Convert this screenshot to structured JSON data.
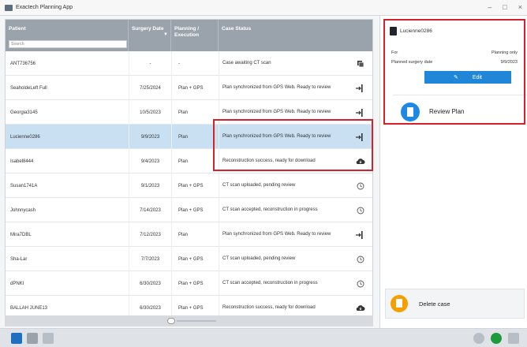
{
  "window": {
    "title": "Exactech Planning App"
  },
  "table": {
    "headers": [
      "Patient",
      "Surgery Date",
      "Planning / Execution",
      "Case Status"
    ],
    "filter_placeholder": "Search",
    "rows": [
      {
        "patient": "ANT736756",
        "date": "-",
        "planning": "-",
        "status": "Case awaiting CT scan",
        "icon": "copy-icon"
      },
      {
        "patient": "SeaholdeLeft Full",
        "date": "7/25/2024",
        "planning": "Plan + GPS",
        "status": "Plan synchronized from GPS Web. Ready to review",
        "icon": "arrow-icon"
      },
      {
        "patient": "Georgia3145",
        "date": "10/5/2023",
        "planning": "Plan",
        "status": "Plan synchronized from GPS Web. Ready to review",
        "icon": "arrow-icon"
      },
      {
        "patient": "Lucienne0286",
        "date": "9/9/2023",
        "planning": "Plan",
        "status": "Plan synchronized from GPS Web. Ready to review",
        "icon": "arrow-icon"
      },
      {
        "patient": "Isabel8444",
        "date": "9/4/2023",
        "planning": "Plan",
        "status": "Reconstruction success, ready for download",
        "icon": "cloud-icon"
      },
      {
        "patient": "Susan1741A",
        "date": "9/1/2023",
        "planning": "Plan + GPS",
        "status": "CT scan uploaded, pending review",
        "icon": "clock-icon"
      },
      {
        "patient": "Johnnycash",
        "date": "7/14/2023",
        "planning": "Plan + GPS",
        "status": "CT scan accepted, reconstruction in progress",
        "icon": "clock-icon"
      },
      {
        "patient": "Mira7DBL",
        "date": "7/12/2023",
        "planning": "Plan",
        "status": "Plan synchronized from GPS Web. Ready to review",
        "icon": "arrow-icon"
      },
      {
        "patient": "Sha-Lar",
        "date": "7/7/2023",
        "planning": "Plan + GPS",
        "status": "CT scan uploaded, pending review",
        "icon": "clock-icon"
      },
      {
        "patient": "dPNKI",
        "date": "6/30/2023",
        "planning": "Plan + GPS",
        "status": "CT scan accepted, reconstruction in progress",
        "icon": "clock-icon"
      },
      {
        "patient": "BALLAH JUNE13",
        "date": "6/30/2023",
        "planning": "Plan + GPS",
        "status": "Reconstruction success, ready for download",
        "icon": "cloud-icon"
      }
    ]
  },
  "panel": {
    "patient_name": "Lucienne0286",
    "for_label": "For",
    "for_value": "Planning only",
    "date_label": "Planned surgery date",
    "date_value": "9/9/2023",
    "edit_label": "Edit",
    "review_label": "Review Plan",
    "delete_label": "Delete case"
  },
  "colors": {
    "accent": "#1f86d8",
    "header": "#9aa3ac",
    "selected": "#c9e0f3",
    "highlight": "#d3222a",
    "delete": "#f5a000"
  }
}
